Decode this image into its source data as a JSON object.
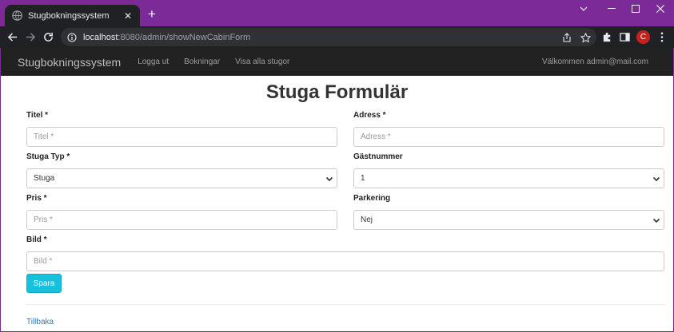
{
  "browser": {
    "tab_title": "Stugbokningssystem",
    "new_tab_symbol": "+",
    "url_host": "localhost",
    "url_rest": ":8080/admin/showNewCabinForm",
    "profile_initial": "C",
    "colors": {
      "frame": "#7b2a97",
      "toolbar": "#202124",
      "profile": "#c5221f"
    }
  },
  "navbar": {
    "brand": "Stugbokningssystem",
    "links": [
      "Logga ut",
      "Bokningar",
      "Visa alla stugor"
    ],
    "welcome": "Välkommen admin@mail.com"
  },
  "page": {
    "title": "Stuga Formulär"
  },
  "form": {
    "title": {
      "label": "Titel *",
      "placeholder": "Titel *"
    },
    "address": {
      "label": "Adress *",
      "placeholder": "Adress *"
    },
    "cabin_type": {
      "label": "Stuga Typ *",
      "selected": "Stuga"
    },
    "guest_number": {
      "label": "Gästnummer",
      "selected": "1"
    },
    "price": {
      "label": "Pris *",
      "placeholder": "Pris *"
    },
    "parking": {
      "label": "Parkering",
      "selected": "Nej"
    },
    "image": {
      "label": "Bild *",
      "placeholder": "Bild *"
    },
    "save_label": "Spara",
    "back_label": "Tillbaka",
    "colors": {
      "save_button": "#17c0dd",
      "link": "#337ab7"
    }
  }
}
